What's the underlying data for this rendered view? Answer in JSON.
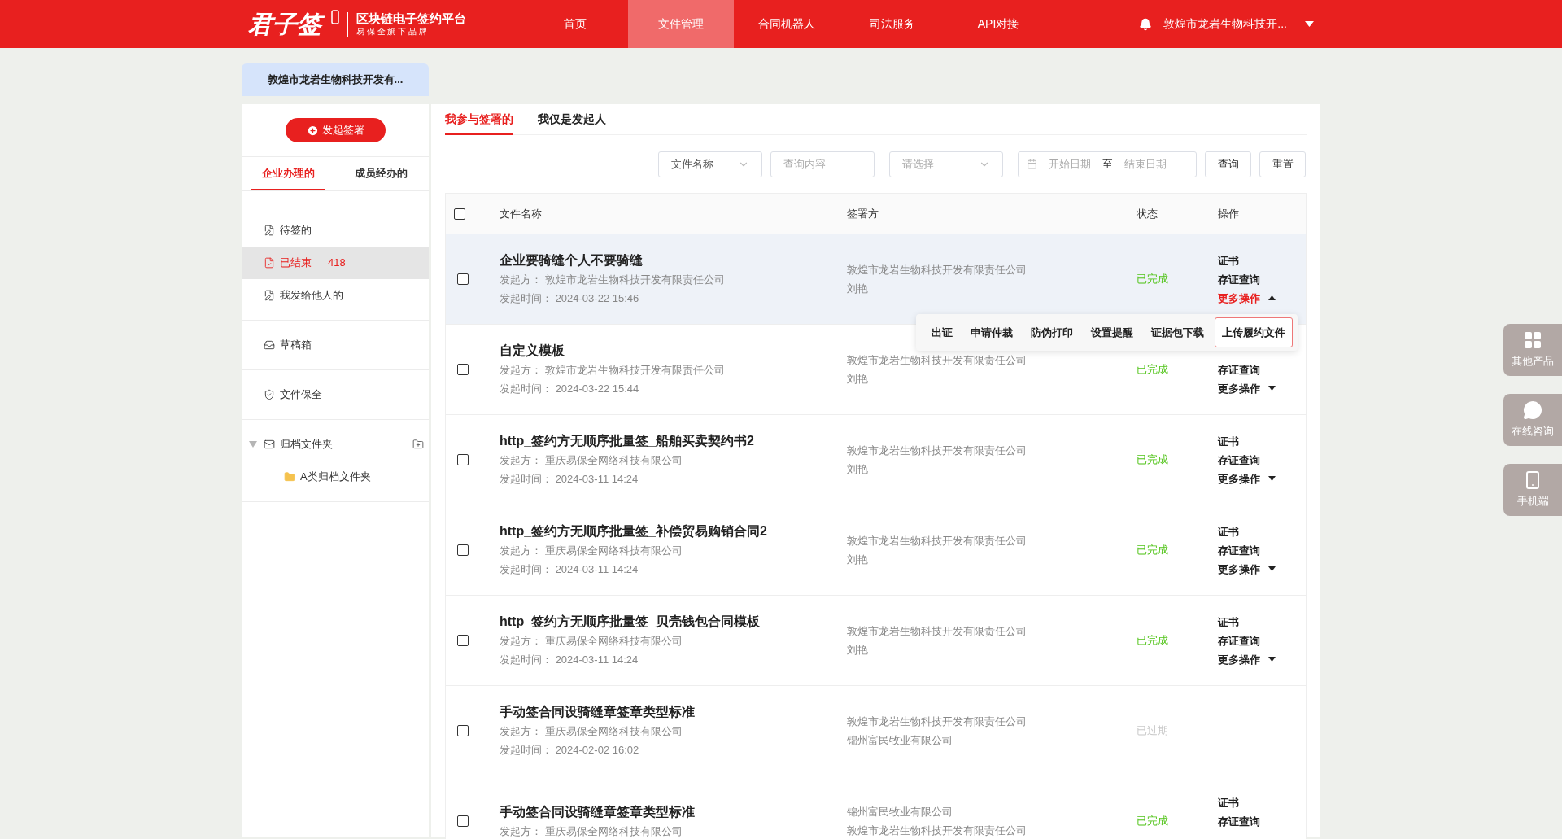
{
  "header": {
    "logo": {
      "brand": "君子签",
      "title": "区块链电子签约平台",
      "subtitle": "易 保 全 旗 下 品 牌"
    },
    "nav": [
      {
        "label": "首页",
        "selected": false
      },
      {
        "label": "文件管理",
        "selected": true
      },
      {
        "label": "合同机器人",
        "selected": false
      },
      {
        "label": "司法服务",
        "selected": false
      },
      {
        "label": "API对接",
        "selected": false
      }
    ],
    "user": {
      "name": "敦煌市龙岩生物科技开..."
    }
  },
  "company_tab": "敦煌市龙岩生物科技开发有...",
  "sidebar": {
    "start_button": "发起签署",
    "tabs": [
      {
        "label": "企业办理的",
        "selected": true
      },
      {
        "label": "成员经办的",
        "selected": false
      }
    ],
    "sections": [
      [
        {
          "kind": "pending",
          "label": "待签的",
          "selected": false
        },
        {
          "kind": "finished",
          "label": "已结束",
          "count": "418",
          "selected": true
        },
        {
          "kind": "sent",
          "label": "我发给他人的",
          "selected": false
        }
      ],
      [
        {
          "kind": "draft",
          "label": "草稿箱",
          "selected": false
        }
      ],
      [
        {
          "kind": "preserve",
          "label": "文件保全",
          "selected": false
        }
      ],
      [
        {
          "kind": "archive",
          "label": "归档文件夹",
          "selected": false,
          "expanded": true,
          "children": [
            {
              "kind": "folder",
              "label": "A类归档文件夹",
              "selected": false
            }
          ]
        }
      ]
    ]
  },
  "main_tabs": [
    {
      "label": "我参与签署的",
      "selected": true
    },
    {
      "label": "我仅是发起人",
      "selected": false
    }
  ],
  "filters": {
    "field_select": "文件名称",
    "query": {
      "placeholder": "查询内容"
    },
    "status_select": {
      "placeholder": "请选择"
    },
    "date_range": {
      "start_placeholder": "开始日期",
      "separator": "至",
      "end_placeholder": "结束日期"
    },
    "buttons": [
      "查询",
      "重置"
    ]
  },
  "table": {
    "header_checkbox": {
      "checked": false
    },
    "columns": [
      "文件名称",
      "签署方",
      "状态",
      "操作"
    ],
    "rows": [
      {
        "checked": false,
        "hovered": true,
        "title": "企业要骑缝个人不要骑缝",
        "initiator_label": "发起方：",
        "initiator": "敦煌市龙岩生物科技开发有限责任公司",
        "time_label": "发起时间：",
        "time": "2024-03-22 15:46",
        "signers": [
          "敦煌市龙岩生物科技开发有限责任公司",
          "刘艳"
        ],
        "status": {
          "text": "已完成",
          "kind": "done"
        },
        "actions": [
          "证书",
          "存证查询"
        ],
        "more": {
          "label": "更多操作",
          "expanded": true,
          "menu": [
            {
              "label": "出证",
              "selected": false
            },
            {
              "label": "申请仲裁",
              "selected": false
            },
            {
              "label": "防伪打印",
              "selected": false
            },
            {
              "label": "设置提醒",
              "selected": false
            },
            {
              "label": "证据包下载",
              "selected": false
            },
            {
              "label": "上传履约文件",
              "selected": true
            }
          ]
        }
      },
      {
        "checked": false,
        "hovered": false,
        "title": "自定义模板",
        "initiator_label": "发起方：",
        "initiator": "敦煌市龙岩生物科技开发有限责任公司",
        "time_label": "发起时间：",
        "time": "2024-03-22 15:44",
        "signers": [
          "敦煌市龙岩生物科技开发有限责任公司",
          "刘艳"
        ],
        "status": {
          "text": "已完成",
          "kind": "done"
        },
        "actions": [
          "存证查询"
        ],
        "more": {
          "label": "更多操作",
          "expanded": false
        }
      },
      {
        "checked": false,
        "hovered": false,
        "title": "http_签约方无顺序批量签_船舶买卖契约书2",
        "initiator_label": "发起方：",
        "initiator": "重庆易保全网络科技有限公司",
        "time_label": "发起时间：",
        "time": "2024-03-11 14:24",
        "signers": [
          "敦煌市龙岩生物科技开发有限责任公司",
          "刘艳"
        ],
        "status": {
          "text": "已完成",
          "kind": "done"
        },
        "actions": [
          "证书",
          "存证查询"
        ],
        "more": {
          "label": "更多操作",
          "expanded": false
        }
      },
      {
        "checked": false,
        "hovered": false,
        "title": "http_签约方无顺序批量签_补偿贸易购销合同2",
        "initiator_label": "发起方：",
        "initiator": "重庆易保全网络科技有限公司",
        "time_label": "发起时间：",
        "time": "2024-03-11 14:24",
        "signers": [
          "敦煌市龙岩生物科技开发有限责任公司",
          "刘艳"
        ],
        "status": {
          "text": "已完成",
          "kind": "done"
        },
        "actions": [
          "证书",
          "存证查询"
        ],
        "more": {
          "label": "更多操作",
          "expanded": false
        }
      },
      {
        "checked": false,
        "hovered": false,
        "title": "http_签约方无顺序批量签_贝壳钱包合同模板",
        "initiator_label": "发起方：",
        "initiator": "重庆易保全网络科技有限公司",
        "time_label": "发起时间：",
        "time": "2024-03-11 14:24",
        "signers": [
          "敦煌市龙岩生物科技开发有限责任公司",
          "刘艳"
        ],
        "status": {
          "text": "已完成",
          "kind": "done"
        },
        "actions": [
          "证书",
          "存证查询"
        ],
        "more": {
          "label": "更多操作",
          "expanded": false
        }
      },
      {
        "checked": false,
        "hovered": false,
        "title": "手动签合同设骑缝章签章类型标准",
        "initiator_label": "发起方：",
        "initiator": "重庆易保全网络科技有限公司",
        "time_label": "发起时间：",
        "time": "2024-02-02 16:02",
        "signers": [
          "敦煌市龙岩生物科技开发有限责任公司",
          "锦州富民牧业有限公司"
        ],
        "status": {
          "text": "已过期",
          "kind": "expired"
        },
        "actions": []
      },
      {
        "checked": false,
        "hovered": false,
        "title": "手动签合同设骑缝章签章类型标准",
        "initiator_label": "发起方：",
        "initiator": "重庆易保全网络科技有限公司",
        "signers": [
          "锦州富民牧业有限公司",
          "敦煌市龙岩生物科技开发有限责任公司"
        ],
        "status": {
          "text": "已完成",
          "kind": "done"
        },
        "actions": [
          "证书",
          "存证查询"
        ]
      }
    ]
  },
  "floating_buttons": [
    {
      "kind": "products",
      "label": "其他产品"
    },
    {
      "kind": "chat",
      "label": "在线咨询"
    },
    {
      "kind": "mobile",
      "label": "手机端"
    }
  ]
}
